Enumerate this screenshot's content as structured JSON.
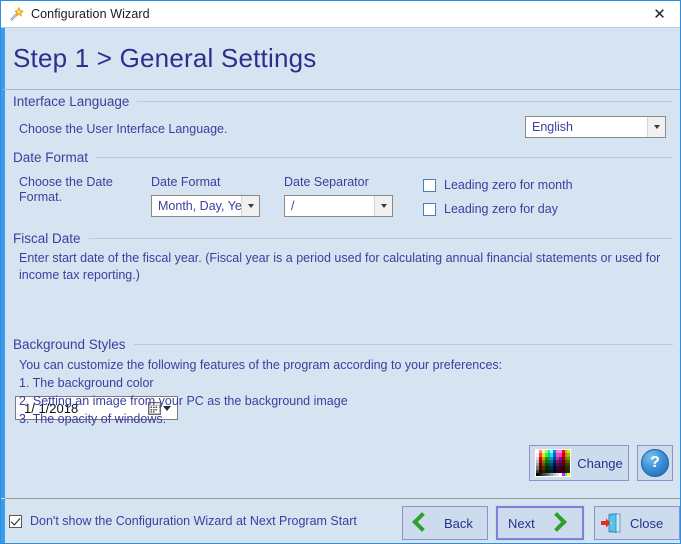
{
  "window": {
    "title": "Configuration Wizard",
    "icon": "magic-wand-icon",
    "close_glyph": "✕"
  },
  "header": {
    "title": "Step 1 > General Settings"
  },
  "sections": {
    "interface_language": {
      "heading": "Interface Language",
      "description": "Choose the User Interface Language.",
      "language_select": {
        "value": "English"
      }
    },
    "date_format": {
      "heading": "Date Format",
      "description": "Choose the Date Format.",
      "format_label": "Date Format",
      "format_select": {
        "value": "Month, Day, Yea"
      },
      "separator_label": "Date Separator",
      "separator_select": {
        "value": "/"
      },
      "leading_zero_month": {
        "label": "Leading zero for month",
        "checked": false
      },
      "leading_zero_day": {
        "label": "Leading zero for day",
        "checked": false
      }
    },
    "fiscal_date": {
      "heading": "Fiscal Date",
      "description": "Enter start date of the fiscal year. (Fiscal year is a period used for calculating annual financial statements or used for income tax reporting.)",
      "date_value": "1/  1/2018"
    },
    "background_styles": {
      "heading": "Background Styles",
      "intro": "You can customize the following features of the program according to your preferences:",
      "item1": "1. The background color",
      "item2": "2. Setting an image from your PC as the background image",
      "item3": "3. The opacity of windows.",
      "change_button": "Change",
      "help_button": "?"
    }
  },
  "footer": {
    "dont_show": {
      "label": "Don't show the Configuration Wizard at Next Program Start",
      "checked": true
    },
    "back_button": "Back",
    "next_button": "Next",
    "close_button": "Close"
  },
  "colors": {
    "window_bg": "#d6e3f0",
    "accent_border": "#3b9bec",
    "title_text": "#2b2f8f",
    "body_text": "#3b3fa0",
    "button_face": "#cddcec",
    "button_border": "#8f8fd0",
    "chevron_green": "#2f9e2f",
    "help_blue": "#3a8fd6"
  },
  "palette_swatches": [
    "#ffffff",
    "#ff8080",
    "#ffff80",
    "#80ff80",
    "#00ff80",
    "#80ffff",
    "#0080ff",
    "#ff80c0",
    "#ff80ff",
    "#ff0000",
    "#ffa000",
    "#a0ff00",
    "#f0f0f0",
    "#ff4040",
    "#ffd040",
    "#40f040",
    "#00d070",
    "#40d0ff",
    "#0060d0",
    "#e060a0",
    "#e040e0",
    "#d00000",
    "#d08000",
    "#80d000",
    "#d8d8d8",
    "#d00000",
    "#d0a000",
    "#00a000",
    "#00a060",
    "#00a0d0",
    "#0040a0",
    "#a04080",
    "#a000a0",
    "#a00000",
    "#a06000",
    "#60a000",
    "#c0c0c0",
    "#a00000",
    "#a07000",
    "#008000",
    "#007040",
    "#0070a0",
    "#002070",
    "#702060",
    "#700070",
    "#700000",
    "#704000",
    "#407000",
    "#a0a0a0",
    "#700000",
    "#705000",
    "#005000",
    "#005030",
    "#005070",
    "#001050",
    "#501040",
    "#500050",
    "#500000",
    "#503000",
    "#305000",
    "#808080",
    "#500000",
    "#503000",
    "#003000",
    "#003020",
    "#003050",
    "#000830",
    "#380830",
    "#380038",
    "#380000",
    "#382000",
    "#203800",
    "#404040",
    "#300000",
    "#302000",
    "#002000",
    "#002018",
    "#002038",
    "#000420",
    "#280420",
    "#280028",
    "#280000",
    "#281800",
    "#182800",
    "#000000",
    "#202020",
    "#404040",
    "#606060",
    "#808080",
    "#a0a0a0",
    "#c0c0c0",
    "#e0e0e0",
    "#ffffff",
    "#ff00ff",
    "#00ffff",
    "#ffff00"
  ]
}
